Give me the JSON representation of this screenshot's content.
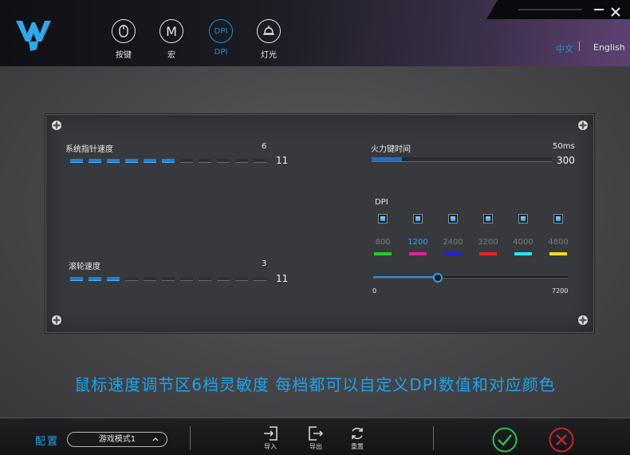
{
  "header": {
    "nav": [
      {
        "label": "按键",
        "icon": "mouse-icon",
        "active": false
      },
      {
        "label": "宏",
        "icon": "macro-m-icon",
        "glyph": "M",
        "active": false
      },
      {
        "label": "DPI",
        "icon": "dpi-icon",
        "glyph": "DPI",
        "active": true
      },
      {
        "label": "灯光",
        "icon": "light-icon",
        "active": false
      }
    ],
    "lang_zh": "中文",
    "lang_en": "English"
  },
  "panel": {
    "pointer_speed": {
      "label": "系统指针速度",
      "value": "6",
      "max": "11",
      "level": 6,
      "segments": 11
    },
    "scroll_speed": {
      "label": "滚轮速度",
      "value": "3",
      "max": "11",
      "level": 3,
      "segments": 11
    },
    "fire_key": {
      "label": "火力键时间",
      "value": "50ms",
      "max": "300",
      "level_fraction": 0.167
    },
    "dpi": {
      "label": "DPI",
      "levels": [
        {
          "value": "800",
          "color": "#22cc22"
        },
        {
          "value": "1200",
          "color": "#e020a0"
        },
        {
          "value": "2400",
          "color": "#2222dd"
        },
        {
          "value": "3200",
          "color": "#ee2222"
        },
        {
          "value": "4000",
          "color": "#22e8f0"
        },
        {
          "value": "4800",
          "color": "#f0e020"
        }
      ],
      "active_index": 1,
      "slider_min": "0",
      "slider_max": "7200",
      "slider_value": 2400
    }
  },
  "caption": "鼠标速度调节区6档灵敏度 每档都可以自定义DPI数值和对应颜色",
  "footer": {
    "config_label": "配置",
    "profile": "游戏模式1",
    "import_label": "导入",
    "export_label": "导出",
    "reset_label": "重置"
  },
  "colors": {
    "accent": "#1aa4ec",
    "ok": "#2fbf4f",
    "cancel": "#c0262f"
  }
}
